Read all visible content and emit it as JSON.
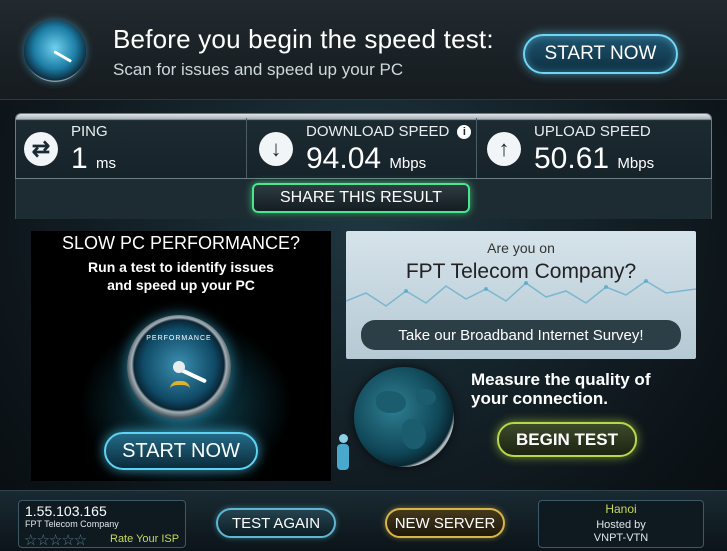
{
  "banner": {
    "title": "Before you begin the speed test:",
    "subtitle": "Scan for issues and speed up your PC",
    "start_label": "START NOW"
  },
  "results": {
    "ping": {
      "label": "PING",
      "value": "1",
      "unit": "ms",
      "icon": "ping-arrows-icon"
    },
    "download": {
      "label": "DOWNLOAD SPEED",
      "value": "94.04",
      "unit": "Mbps",
      "icon": "download-arrow-icon",
      "info": "i"
    },
    "upload": {
      "label": "UPLOAD SPEED",
      "value": "50.61",
      "unit": "Mbps",
      "icon": "upload-arrow-icon"
    }
  },
  "share": {
    "label": "SHARE THIS RESULT"
  },
  "ad_left": {
    "title": "SLOW PC PERFORMANCE?",
    "line1": "Run a test to identify issues",
    "line2": "and speed up your PC",
    "gauge_label": "PERFORMANCE",
    "start_label": "START NOW"
  },
  "survey": {
    "line1": "Are you on",
    "line2": "FPT Telecom Company?",
    "button_label": "Take our Broadband Internet Survey!"
  },
  "measure": {
    "line1": "Measure the quality of",
    "line2": "your connection.",
    "button_label": "BEGIN TEST"
  },
  "footer": {
    "ip": "1.55.103.165",
    "isp": "FPT Telecom Company",
    "stars": "☆☆☆☆☆",
    "rate_label": "Rate Your ISP",
    "test_again": "TEST AGAIN",
    "new_server": "NEW SERVER",
    "server_city": "Hanoi",
    "hosted_by": "Hosted by",
    "host": "VNPT-VTN"
  },
  "colors": {
    "accent_blue": "#6fd6f5",
    "share_green": "#4be58e",
    "begin_lime": "#b8d84a",
    "server_gold": "#d9b64a"
  }
}
